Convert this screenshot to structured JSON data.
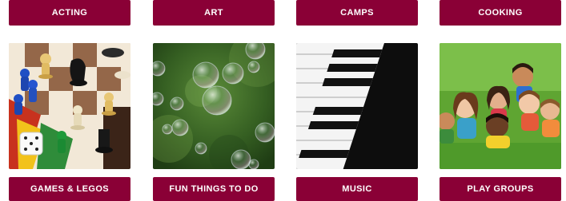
{
  "top_row": {
    "buttons": [
      {
        "label": "ACTING"
      },
      {
        "label": "ART"
      },
      {
        "label": "CAMPS"
      },
      {
        "label": "COOKING"
      }
    ]
  },
  "bottom_row": {
    "buttons": [
      {
        "label": "GAMES & LEGOS"
      },
      {
        "label": "FUN THINGS TO DO"
      },
      {
        "label": "MUSIC"
      },
      {
        "label": "PLAY GROUPS"
      }
    ]
  },
  "colors": {
    "button_bg": "#8a0036",
    "button_text": "#ffffff"
  }
}
